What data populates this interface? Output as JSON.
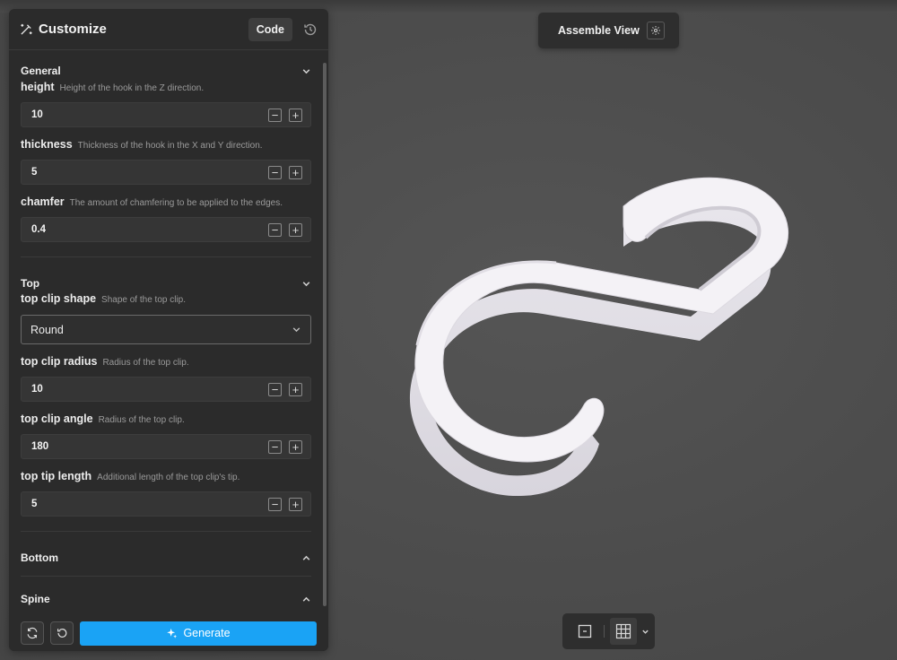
{
  "panel": {
    "title": "Customize",
    "code_label": "Code",
    "sections": {
      "general": {
        "label": "General",
        "fields": [
          {
            "name": "height",
            "desc": "Height of the hook in the Z direction.",
            "value": "10"
          },
          {
            "name": "thickness",
            "desc": "Thickness of the hook in the X and Y direction.",
            "value": "5"
          },
          {
            "name": "chamfer",
            "desc": "The amount of chamfering to be applied to the edges.",
            "value": "0.4"
          }
        ]
      },
      "top": {
        "label": "Top",
        "shape": {
          "name": "top clip shape",
          "desc": "Shape of the top clip.",
          "value": "Round"
        },
        "fields": [
          {
            "name": "top clip radius",
            "desc": "Radius of the top clip.",
            "value": "10"
          },
          {
            "name": "top clip angle",
            "desc": "Radius of the top clip.",
            "value": "180"
          },
          {
            "name": "top tip length",
            "desc": "Additional length of the top clip's tip.",
            "value": "5"
          }
        ]
      },
      "bottom": {
        "label": "Bottom"
      },
      "spine": {
        "label": "Spine"
      }
    },
    "generate_label": "Generate"
  },
  "viewer": {
    "assemble_label": "Assemble View"
  },
  "colors": {
    "accent": "#1aa3f5",
    "panel_bg": "#2b2b2b",
    "viewport_bg": "#4a4a4a",
    "model": "#f2f0f4"
  },
  "icons": {
    "header": "customize-wand-icon",
    "history": "history-icon",
    "gear": "gear-icon",
    "chevron_down": "chevron-down-icon",
    "chevron_up": "chevron-up-icon",
    "refresh": "refresh-icon",
    "undo": "undo-icon",
    "sparkle": "sparkle-icon",
    "frame": "frame-icon",
    "grid": "grid-icon"
  }
}
